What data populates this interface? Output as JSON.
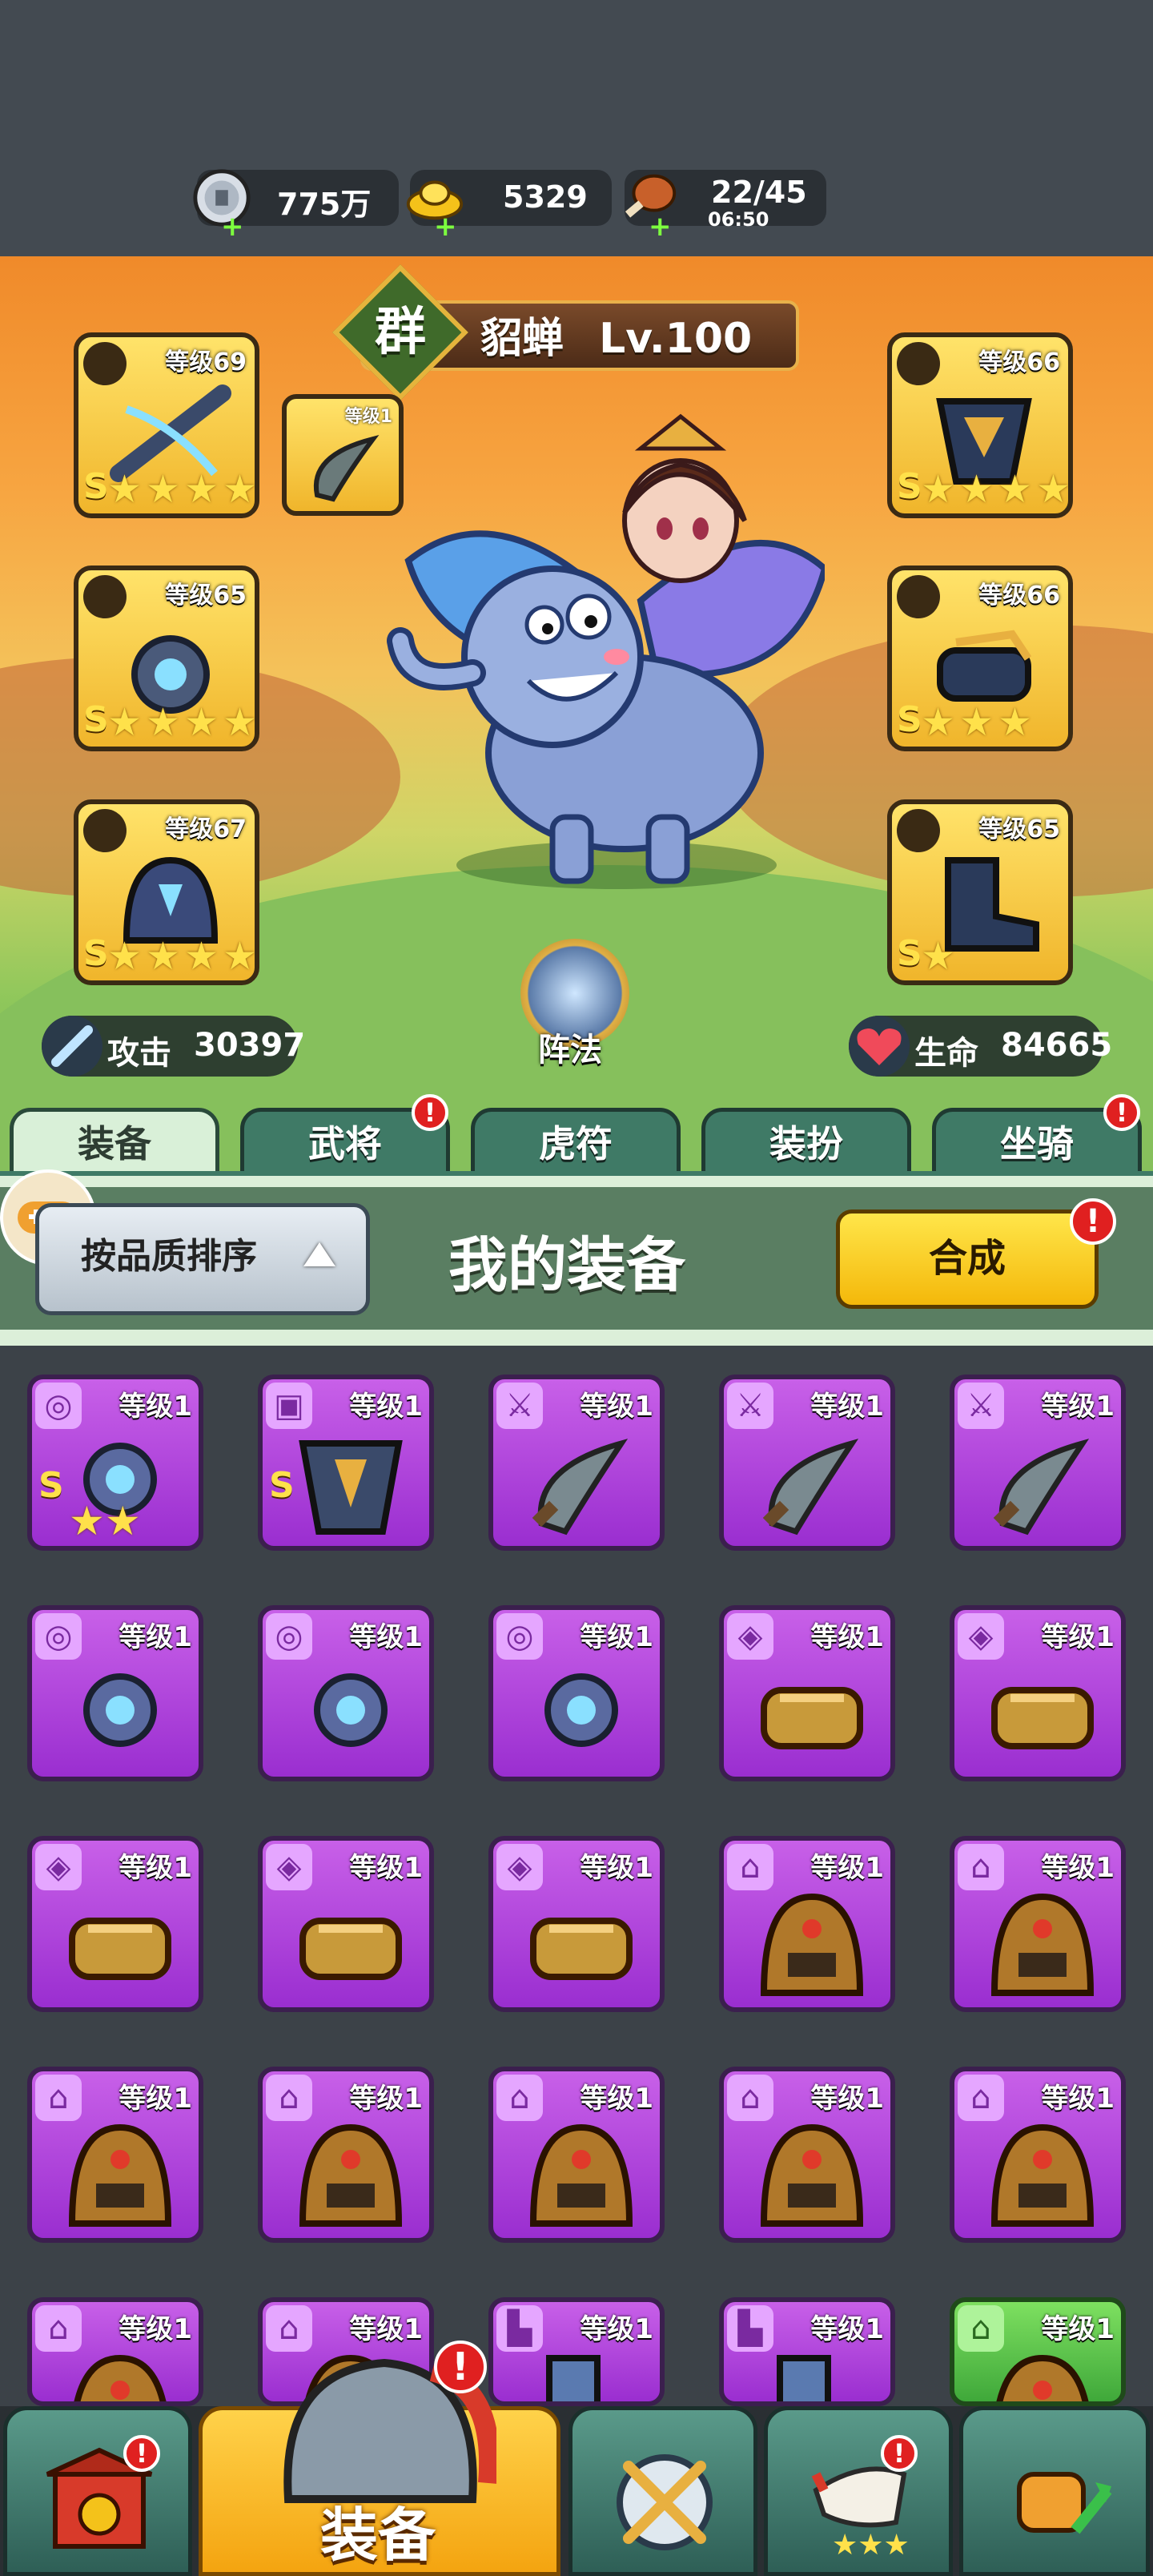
{
  "resources": [
    {
      "name": "silver-coin",
      "value": "775万"
    },
    {
      "name": "gold-ingot",
      "value": "5329"
    },
    {
      "name": "stamina-meat",
      "value": "22/45",
      "timer": "06:50"
    }
  ],
  "hero": {
    "faction": "群",
    "name": "貂蝉",
    "level": "Lv.100",
    "formation_label": "阵法",
    "attack_label": "攻击",
    "attack_value": "30397",
    "hp_label": "生命",
    "hp_value": "84665"
  },
  "equipped": {
    "left": [
      {
        "level": "等级69",
        "stars": 4,
        "grade": "S"
      },
      {
        "level": "等级65",
        "stars": 4,
        "grade": "S"
      },
      {
        "level": "等级67",
        "stars": 4,
        "grade": "S"
      }
    ],
    "right": [
      {
        "level": "等级66",
        "stars": 4,
        "grade": "S"
      },
      {
        "level": "等级66",
        "stars": 3,
        "grade": "S"
      },
      {
        "level": "等级65",
        "stars": 1,
        "grade": "S"
      }
    ],
    "weapon": {
      "level": "等级1"
    }
  },
  "tabs": [
    "装备",
    "武将",
    "虎符",
    "装扮",
    "坐骑"
  ],
  "panel": {
    "sort_label": "按品质排序",
    "title": "我的装备",
    "merge_label": "合成"
  },
  "items": [
    {
      "level": "等级1",
      "type": "amulet",
      "grade": "S",
      "stars": "★★"
    },
    {
      "level": "等级1",
      "type": "armor",
      "grade": "S",
      "stars": ""
    },
    {
      "level": "等级1",
      "type": "weapon",
      "grade": "",
      "stars": ""
    },
    {
      "level": "等级1",
      "type": "weapon",
      "grade": "",
      "stars": ""
    },
    {
      "level": "等级1",
      "type": "weapon",
      "grade": "",
      "stars": ""
    },
    {
      "level": "等级1",
      "type": "amulet",
      "grade": "",
      "stars": ""
    },
    {
      "level": "等级1",
      "type": "amulet",
      "grade": "",
      "stars": ""
    },
    {
      "level": "等级1",
      "type": "amulet",
      "grade": "",
      "stars": ""
    },
    {
      "level": "等级1",
      "type": "bracer",
      "grade": "",
      "stars": ""
    },
    {
      "level": "等级1",
      "type": "bracer",
      "grade": "",
      "stars": ""
    },
    {
      "level": "等级1",
      "type": "bracer",
      "grade": "",
      "stars": ""
    },
    {
      "level": "等级1",
      "type": "bracer",
      "grade": "",
      "stars": ""
    },
    {
      "level": "等级1",
      "type": "bracer",
      "grade": "",
      "stars": ""
    },
    {
      "level": "等级1",
      "type": "helmet",
      "grade": "",
      "stars": ""
    },
    {
      "level": "等级1",
      "type": "helmet",
      "grade": "",
      "stars": ""
    },
    {
      "level": "等级1",
      "type": "helmet",
      "grade": "",
      "stars": ""
    },
    {
      "level": "等级1",
      "type": "helmet",
      "grade": "",
      "stars": ""
    },
    {
      "level": "等级1",
      "type": "helmet",
      "grade": "",
      "stars": ""
    },
    {
      "level": "等级1",
      "type": "helmet",
      "grade": "",
      "stars": ""
    },
    {
      "level": "等级1",
      "type": "helmet",
      "grade": "",
      "stars": ""
    },
    {
      "level": "等级1",
      "type": "helmet",
      "grade": "",
      "stars": ""
    },
    {
      "level": "等级1",
      "type": "helmet",
      "grade": "",
      "stars": ""
    },
    {
      "level": "等级1",
      "type": "boots",
      "grade": "",
      "stars": ""
    },
    {
      "level": "等级1",
      "type": "boots",
      "grade": "",
      "stars": ""
    },
    {
      "level": "等级1",
      "type": "helmet",
      "grade": "",
      "stars": "",
      "rarity": "green"
    }
  ],
  "nav": {
    "active_label": "装备"
  }
}
